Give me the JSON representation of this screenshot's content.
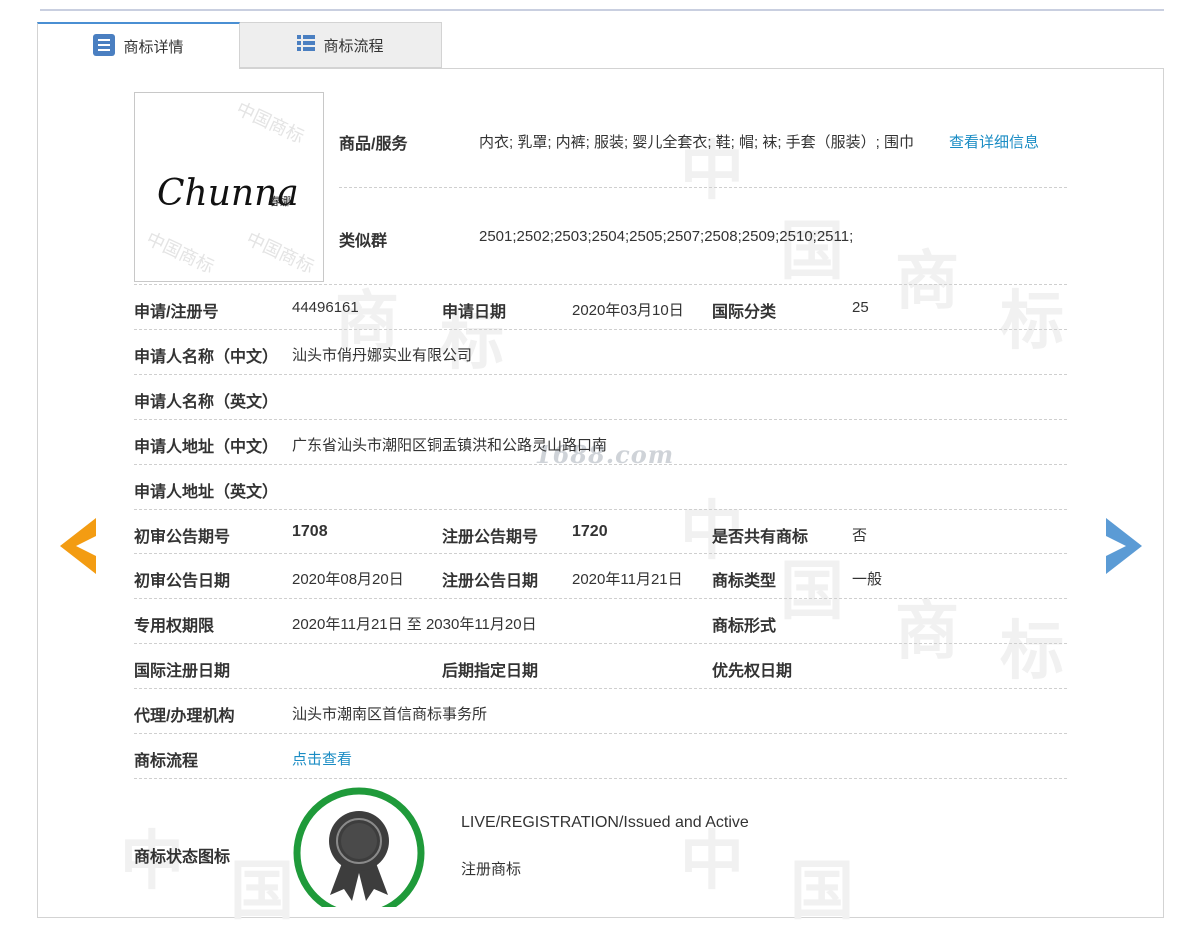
{
  "tabs": [
    {
      "label": "商标详情",
      "icon": "document-list-icon"
    },
    {
      "label": "商标流程",
      "icon": "grid-list-icon"
    }
  ],
  "logo": {
    "text": "Chunna",
    "sub": "春娜"
  },
  "goods": {
    "label": "商品/服务",
    "value": "内衣; 乳罩; 内裤; 服装; 婴儿全套衣; 鞋; 帽; 袜; 手套（服装）; 围巾",
    "link": "查看详细信息"
  },
  "similar": {
    "label": "类似群",
    "value": "2501;2502;2503;2504;2505;2507;2508;2509;2510;2511;"
  },
  "rows": {
    "reg_no_label": "申请/注册号",
    "reg_no": "44496161",
    "apply_date_label": "申请日期",
    "apply_date": "2020年03月10日",
    "intl_class_label": "国际分类",
    "intl_class": "25",
    "applicant_cn_label": "申请人名称（中文）",
    "applicant_cn": "汕头市俏丹娜实业有限公司",
    "applicant_en_label": "申请人名称（英文）",
    "applicant_en": "",
    "address_cn_label": "申请人地址（中文）",
    "address_cn": "广东省汕头市潮阳区铜盂镇洪和公路灵山路口南",
    "address_en_label": "申请人地址（英文）",
    "address_en": "",
    "prelim_no_label": "初审公告期号",
    "prelim_no": "1708",
    "reg_pub_no_label": "注册公告期号",
    "reg_pub_no": "1720",
    "shared_label": "是否共有商标",
    "shared": "否",
    "prelim_date_label": "初审公告日期",
    "prelim_date": "2020年08月20日",
    "reg_pub_date_label": "注册公告日期",
    "reg_pub_date": "2020年11月21日",
    "tm_type_label": "商标类型",
    "tm_type": "一般",
    "term_label": "专用权期限",
    "term": "2020年11月21日 至 2030年11月20日",
    "tm_form_label": "商标形式",
    "tm_form": "",
    "intl_reg_date_label": "国际注册日期",
    "later_date_label": "后期指定日期",
    "priority_date_label": "优先权日期",
    "agent_label": "代理/办理机构",
    "agent": "汕头市潮南区首信商标事务所",
    "flow_label": "商标流程",
    "flow_link": "点击查看",
    "status_icon_label": "商标状态图标"
  },
  "status": {
    "en": "LIVE/REGISTRATION/Issued and Active",
    "cn": "注册商标"
  },
  "watermark": {
    "site": "1688.com",
    "chars": [
      "中",
      "国",
      "商",
      "标"
    ]
  },
  "colors": {
    "link": "#1a8cc4",
    "tab_active_border": "#4a8fd3",
    "prev_arrow": "#f39c12",
    "next_arrow": "#5b9bd5",
    "badge_ring": "#1f9a3a"
  }
}
